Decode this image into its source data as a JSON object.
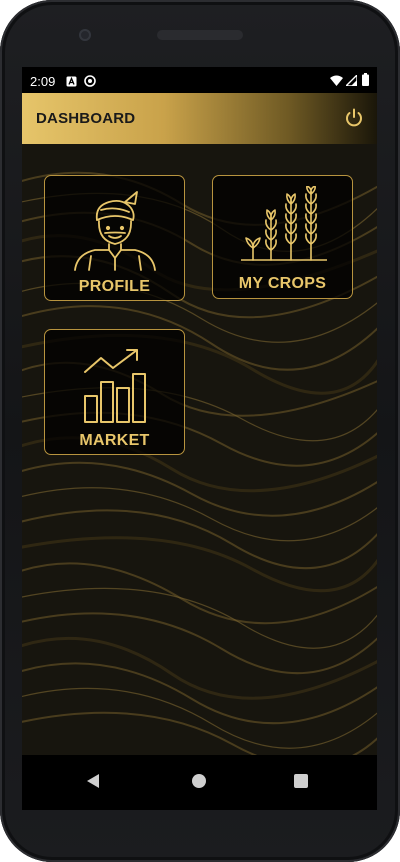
{
  "status_bar": {
    "time": "2:09",
    "icons": [
      "notification-a-icon",
      "sync-icon",
      "wifi-icon",
      "signal-icon",
      "battery-icon"
    ]
  },
  "app_bar": {
    "title": "DASHBOARD",
    "action_icon": "power-icon"
  },
  "tiles": [
    {
      "label": "PROFILE",
      "icon": "farmer-icon"
    },
    {
      "label": "MY CROPS",
      "icon": "wheat-icon"
    },
    {
      "label": "MARKET",
      "icon": "growth-chart-icon"
    }
  ],
  "nav": {
    "icons": [
      "back-icon",
      "home-icon",
      "recents-icon"
    ]
  },
  "colors": {
    "accent_gold": "#e8c66a",
    "tile_border": "#b8943f",
    "status_bg": "#000000"
  }
}
